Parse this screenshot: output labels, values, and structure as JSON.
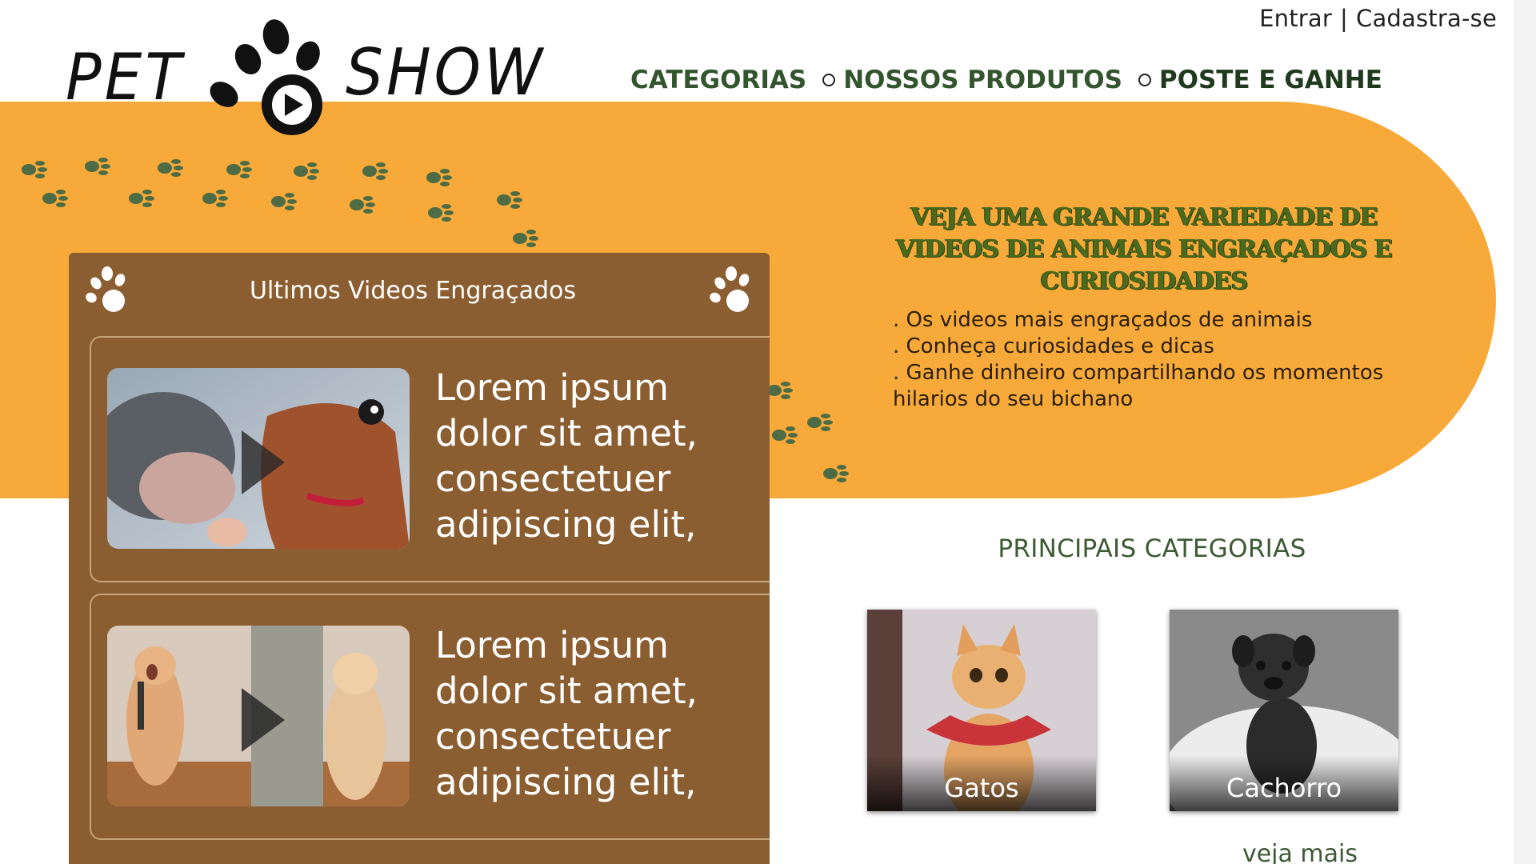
{
  "auth": {
    "login": "Entrar",
    "separator": "|",
    "signup": "Cadastra-se"
  },
  "logo": {
    "word_left": "PET",
    "word_right": "SHOW"
  },
  "nav": {
    "items": [
      {
        "label": "CATEGORIAS"
      },
      {
        "label": "NOSSOS PRODUTOS"
      },
      {
        "label": "POSTE E GANHE"
      }
    ]
  },
  "promo": {
    "title_line1": "VEJA UMA GRANDE VARIEDADE DE",
    "title_line2": "VIDEOS DE ANIMAIS ENGRAÇADOS E CURIOSIDADES",
    "bullets": [
      ". Os videos mais engraçados de animais",
      ". Conheça curiosidades e dicas",
      ". Ganhe dinheiro compartilhando os momentos hilarios do seu bichano"
    ]
  },
  "videos": {
    "title": "Ultimos Videos Engraçados",
    "items": [
      {
        "text": "Lorem ipsum dolor sit amet, consectetuer adipiscing elit,",
        "thumb_icon": "dog-fish-thumbnail"
      },
      {
        "text": "Lorem ipsum dolor sit amet, consectetuer adipiscing elit,",
        "thumb_icon": "singing-cats-thumbnail"
      }
    ]
  },
  "categories": {
    "heading": "PRINCIPAIS CATEGORIAS",
    "items": [
      {
        "label": "Gatos"
      },
      {
        "label": "Cachorro"
      }
    ],
    "see_more": "veja mais"
  },
  "colors": {
    "orange": "#f7aa39",
    "brown_panel": "#8b5e31",
    "nav_green": "#33552e",
    "paw_green": "#4d6b45"
  }
}
